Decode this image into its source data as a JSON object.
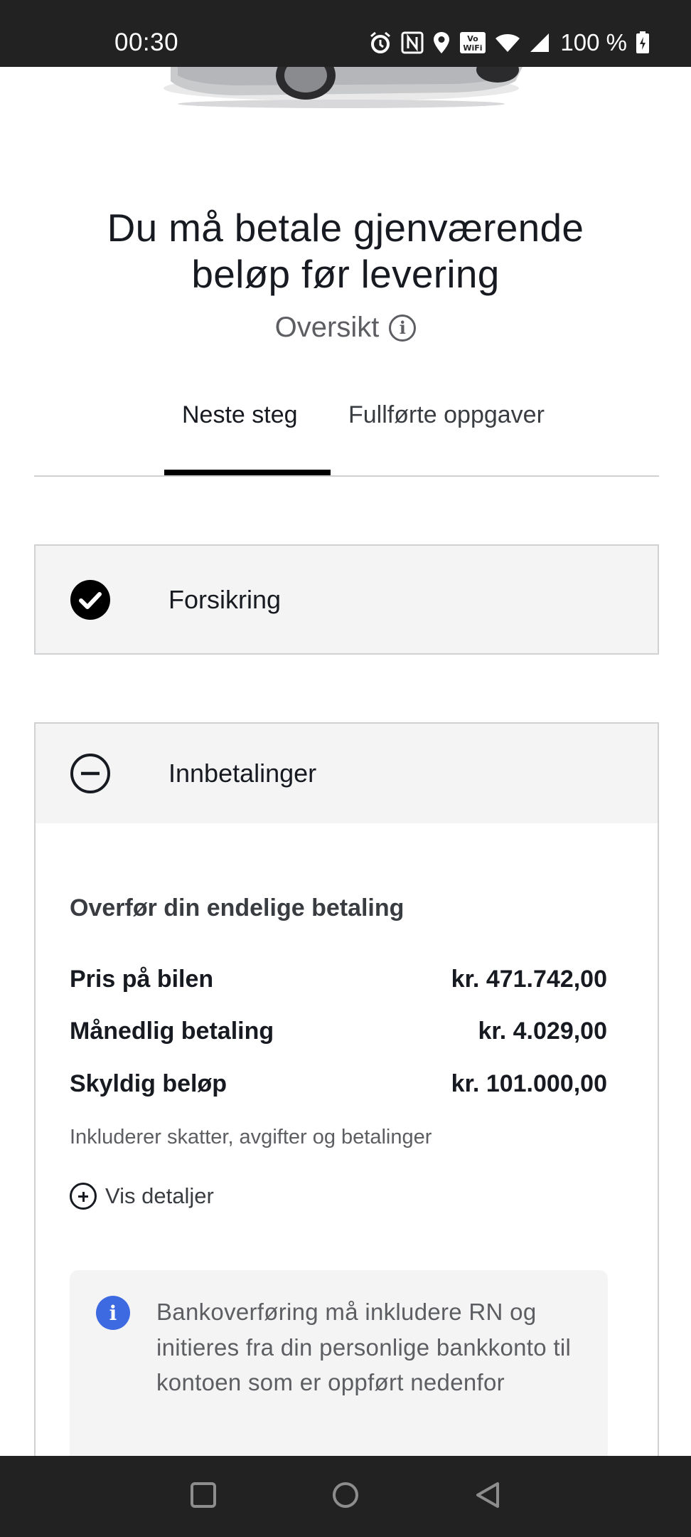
{
  "status_bar": {
    "time": "00:30",
    "battery": "100 %",
    "icons": [
      "alarm-icon",
      "nfc-icon",
      "location-icon",
      "vowifi-icon",
      "wifi-icon",
      "signal-icon",
      "battery-charging-icon"
    ]
  },
  "header": {
    "headline_line1": "Du må betale gjenværende",
    "headline_line2": "beløp før levering",
    "overview_label": "Oversikt"
  },
  "tabs": [
    {
      "label": "Neste steg",
      "active": true
    },
    {
      "label": "Fullførte oppgaver",
      "active": false
    }
  ],
  "insurance": {
    "title": "Forsikring",
    "status": "completed"
  },
  "payments": {
    "title": "Innbetalinger",
    "expanded": true,
    "section_title": "Overfør din endelige betaling",
    "rows": [
      {
        "label": "Pris på bilen",
        "value": "kr. 471.742,00"
      },
      {
        "label": "Månedlig betaling",
        "value": "kr. 4.029,00"
      },
      {
        "label": "Skyldig beløp",
        "value": "kr. 101.000,00"
      }
    ],
    "note": "Inkluderer skatter, avgifter og betalinger",
    "details_link": "Vis detaljer",
    "info_text": "Bankoverføring må inkludere RN og initieres fra din personlige bankkonto til kontoen som er oppført nedenfor"
  },
  "colors": {
    "accent_blue": "#3e6ae1",
    "text_primary": "#171a20",
    "text_secondary": "#5c5e62",
    "panel_bg": "#f4f4f4",
    "system_bar": "#222222"
  }
}
